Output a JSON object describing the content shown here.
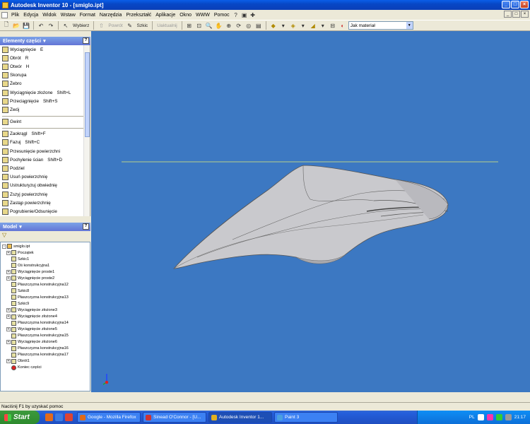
{
  "window": {
    "title": "Autodesk Inventor 10 - [smiglo.ipt]",
    "controls": [
      "_",
      "□",
      "×"
    ]
  },
  "menu": {
    "items": [
      "Plik",
      "Edycja",
      "Widok",
      "Wstaw",
      "Format",
      "Narzędzia",
      "Przekształć",
      "Aplikacje",
      "Okno",
      "WWW",
      "Pomoc"
    ]
  },
  "toolbar": {
    "select_label": "Wybierz",
    "return_label": "Powrót",
    "sketch_label": "Szkic",
    "update_label": "Uaktualnij",
    "color_select": "Jak materiał"
  },
  "features_panel": {
    "title": "Elementy części",
    "help": "?",
    "groups": [
      [
        {
          "label": "Wyciągnięcie",
          "shortcut": "E"
        },
        {
          "label": "Obrót",
          "shortcut": "R"
        },
        {
          "label": "Otwór",
          "shortcut": "H"
        },
        {
          "label": "Skorupa",
          "shortcut": ""
        },
        {
          "label": "Żebro",
          "shortcut": ""
        },
        {
          "label": "Wyciągnięcie złożone",
          "shortcut": "Shift+L"
        },
        {
          "label": "Przeciągnięcie",
          "shortcut": "Shift+S"
        },
        {
          "label": "Zwój",
          "shortcut": ""
        }
      ],
      [
        {
          "label": "Gwint",
          "shortcut": ""
        }
      ],
      [
        {
          "label": "Zaokrągl",
          "shortcut": "Shift+F"
        },
        {
          "label": "Fazuj",
          "shortcut": "Shift+C"
        },
        {
          "label": "Przesunięcie powierzchni",
          "shortcut": ""
        },
        {
          "label": "Pochylenie ścian",
          "shortcut": "Shift+D"
        },
        {
          "label": "Podziel",
          "shortcut": ""
        },
        {
          "label": "Usuń powierzchnię",
          "shortcut": ""
        },
        {
          "label": "Ustrukturyzuj obwiednię",
          "shortcut": ""
        },
        {
          "label": "Zszyj powierzchnię",
          "shortcut": ""
        },
        {
          "label": "Zastąp powierzchnię",
          "shortcut": ""
        },
        {
          "label": "Pogrubienie/Odsunięcie",
          "shortcut": ""
        }
      ]
    ]
  },
  "model_panel": {
    "title": "Model",
    "help": "?",
    "filter_icon": "filter-icon",
    "tree": [
      {
        "label": "smiglo.ipt",
        "level": 0,
        "expander": "-",
        "kind": "root"
      },
      {
        "label": "Początek",
        "level": 1,
        "expander": "+",
        "kind": "folder"
      },
      {
        "label": "Szkic1",
        "level": 1,
        "expander": "",
        "kind": "sketch"
      },
      {
        "label": "Oś konstrukcyjna1",
        "level": 1,
        "expander": "",
        "kind": "axis"
      },
      {
        "label": "Wyciągnięcie proste1",
        "level": 1,
        "expander": "+",
        "kind": "feature"
      },
      {
        "label": "Wyciągnięcie proste2",
        "level": 1,
        "expander": "+",
        "kind": "feature"
      },
      {
        "label": "Płaszczyzna konstrukcyjna12",
        "level": 1,
        "expander": "",
        "kind": "plane"
      },
      {
        "label": "Szkic8",
        "level": 1,
        "expander": "",
        "kind": "sketch"
      },
      {
        "label": "Płaszczyzna konstrukcyjna13",
        "level": 1,
        "expander": "",
        "kind": "plane"
      },
      {
        "label": "Szkic9",
        "level": 1,
        "expander": "",
        "kind": "sketch"
      },
      {
        "label": "Wyciągnięcie złożone3",
        "level": 1,
        "expander": "+",
        "kind": "feature"
      },
      {
        "label": "Wyciągnięcie złożone4",
        "level": 1,
        "expander": "+",
        "kind": "feature"
      },
      {
        "label": "Płaszczyzna konstrukcyjna14",
        "level": 1,
        "expander": "",
        "kind": "plane"
      },
      {
        "label": "Wyciągnięcie złożone5",
        "level": 1,
        "expander": "+",
        "kind": "feature"
      },
      {
        "label": "Płaszczyzna konstrukcyjna15",
        "level": 1,
        "expander": "",
        "kind": "plane"
      },
      {
        "label": "Wyciągnięcie złożone6",
        "level": 1,
        "expander": "+",
        "kind": "feature"
      },
      {
        "label": "Płaszczyzna konstrukcyjna16",
        "level": 1,
        "expander": "",
        "kind": "plane"
      },
      {
        "label": "Płaszczyzna konstrukcyjna17",
        "level": 1,
        "expander": "",
        "kind": "plane"
      },
      {
        "label": "Obrót1",
        "level": 1,
        "expander": "+",
        "kind": "feature"
      },
      {
        "label": "Koniec części",
        "level": 1,
        "expander": "",
        "kind": "end"
      }
    ]
  },
  "status": {
    "text": "Naciśnij F1 by uzyskać pomoc"
  },
  "taskbar": {
    "start_label": "Start",
    "tasks": [
      {
        "label": "Google - Mozilla Firefox",
        "active": false,
        "color": "#e06a1a"
      },
      {
        "label": "Sinead O'Connor - [U...",
        "active": false,
        "color": "#c33"
      },
      {
        "label": "Autodesk Inventor 1...",
        "active": true,
        "color": "#e0b020"
      },
      {
        "label": "Paint 3",
        "active": false,
        "color": "#4aa0e0"
      }
    ],
    "lang": "PL",
    "clock": "21:17"
  },
  "colors": {
    "viewport": "#3c78c2",
    "part": "#c9c9cd",
    "horizon": "#b7d08a"
  }
}
